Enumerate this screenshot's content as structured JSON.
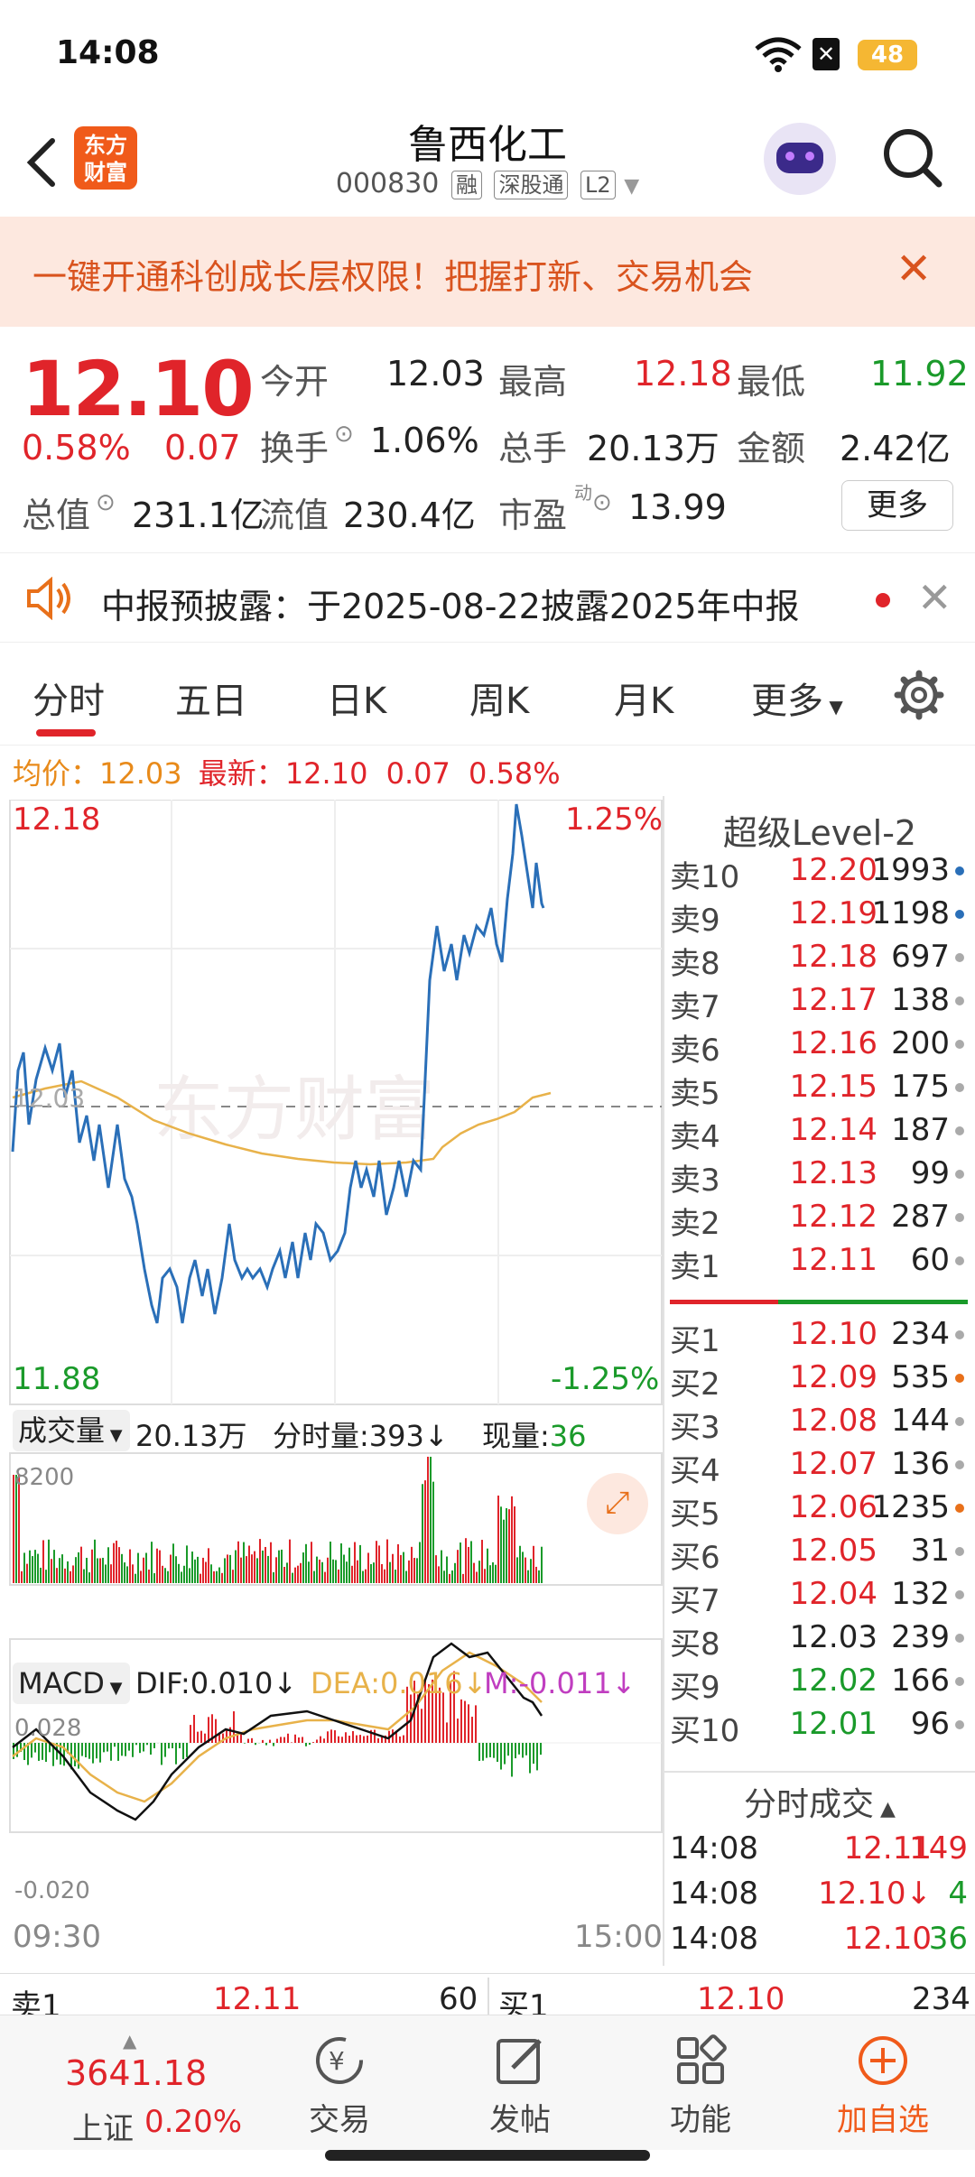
{
  "status": {
    "time": "14:08",
    "battery": "48"
  },
  "header": {
    "logo_line1": "东方",
    "logo_line2": "财富",
    "stock_name": "鲁西化工",
    "stock_code": "000830",
    "tags": [
      "融",
      "深股通",
      "L2"
    ]
  },
  "banner": {
    "text": "一键开通科创成长层权限！把握打新、交易机会"
  },
  "quote": {
    "last_price": "12.10",
    "change_pct": "0.58%",
    "change_amt": "0.07",
    "open_label": "今开",
    "open": "12.03",
    "high_label": "最高",
    "high": "12.18",
    "low_label": "最低",
    "low": "11.92",
    "turnover_label": "换手",
    "turnover": "1.06%",
    "volume_label": "总手",
    "volume": "20.13万",
    "amount_label": "金额",
    "amount": "2.42亿",
    "mktcap_label": "总值",
    "mktcap": "231.1亿",
    "float_label": "流值",
    "float": "230.4亿",
    "pe_label": "市盈",
    "pe_sup": "动",
    "pe": "13.99",
    "more_label": "更多"
  },
  "notice": {
    "text": "中报预披露：于2025-08-22披露2025年中报"
  },
  "tabs": [
    "分时",
    "五日",
    "日K",
    "周K",
    "月K",
    "更多"
  ],
  "avg_line": {
    "avg_label": "均价：",
    "avg": "12.03",
    "latest_label": "最新：",
    "latest": "12.10",
    "chg": "0.07",
    "pct": "0.58%"
  },
  "chart_axis": {
    "price_top": "12.18",
    "price_bottom": "11.88",
    "pct_top": "1.25%",
    "pct_bottom": "-1.25%",
    "mid": "12.03",
    "watermark": "东方财富",
    "time_start": "09:30",
    "time_end": "15:00"
  },
  "volume_header": {
    "selector": "成交量",
    "total": "20.13万",
    "period_label": "分时量:",
    "period": "393",
    "now_label": "现量:",
    "now": "36",
    "max": "8200"
  },
  "macd_header": {
    "selector": "MACD",
    "dif": "DIF:0.010",
    "dea": "DEA:0.016",
    "m": "M:-0.011",
    "top": "0.028",
    "bottom": "-0.020"
  },
  "order_book": {
    "title": "超级Level-2",
    "asks": [
      {
        "label": "卖10",
        "price": "12.20",
        "vol": "1993",
        "dot": "#2a6fb8"
      },
      {
        "label": "卖9",
        "price": "12.19",
        "vol": "1198",
        "dot": "#2a6fb8"
      },
      {
        "label": "卖8",
        "price": "12.18",
        "vol": "697",
        "dot": "#aaaaaa"
      },
      {
        "label": "卖7",
        "price": "12.17",
        "vol": "138",
        "dot": "#aaaaaa"
      },
      {
        "label": "卖6",
        "price": "12.16",
        "vol": "200",
        "dot": "#aaaaaa"
      },
      {
        "label": "卖5",
        "price": "12.15",
        "vol": "175",
        "dot": "#aaaaaa"
      },
      {
        "label": "卖4",
        "price": "12.14",
        "vol": "187",
        "dot": "#aaaaaa"
      },
      {
        "label": "卖3",
        "price": "12.13",
        "vol": "99",
        "dot": "#aaaaaa"
      },
      {
        "label": "卖2",
        "price": "12.12",
        "vol": "287",
        "dot": "#aaaaaa"
      },
      {
        "label": "卖1",
        "price": "12.11",
        "vol": "60",
        "dot": "#aaaaaa"
      }
    ],
    "bids": [
      {
        "label": "买1",
        "price": "12.10",
        "vol": "234",
        "dot": "#aaaaaa"
      },
      {
        "label": "买2",
        "price": "12.09",
        "vol": "535",
        "dot": "#e8701a"
      },
      {
        "label": "买3",
        "price": "12.08",
        "vol": "144",
        "dot": "#aaaaaa"
      },
      {
        "label": "买4",
        "price": "12.07",
        "vol": "136",
        "dot": "#aaaaaa"
      },
      {
        "label": "买5",
        "price": "12.06",
        "vol": "1235",
        "dot": "#e8701a"
      },
      {
        "label": "买6",
        "price": "12.05",
        "vol": "31",
        "dot": "#aaaaaa"
      },
      {
        "label": "买7",
        "price": "12.04",
        "vol": "132",
        "dot": "#aaaaaa"
      },
      {
        "label": "买8",
        "price": "12.03",
        "vol": "239",
        "dot": "#aaaaaa"
      },
      {
        "label": "买9",
        "price": "12.02",
        "vol": "166",
        "dot": "#aaaaaa"
      },
      {
        "label": "买10",
        "price": "12.01",
        "vol": "96",
        "dot": "#aaaaaa"
      }
    ]
  },
  "trades": {
    "title": "分时成交",
    "rows": [
      {
        "time": "14:08",
        "price": "12.11",
        "vol": "149"
      },
      {
        "time": "14:08",
        "price": "12.10↓",
        "vol": "4"
      },
      {
        "time": "14:08",
        "price": "12.10",
        "vol": "36"
      }
    ]
  },
  "bottom_quote": {
    "ask_label": "卖1",
    "ask_price": "12.11",
    "ask_vol": "60",
    "bid_label": "买1",
    "bid_price": "12.10",
    "bid_vol": "234"
  },
  "bottom_nav": {
    "index_value": "3641.18",
    "index_name": "上证",
    "index_pct": "0.20%",
    "trade": "交易",
    "post": "发帖",
    "function": "功能",
    "watch": "加自选"
  },
  "colors": {
    "up": "#e0242a",
    "down": "#1a9a2a",
    "price_line": "#2a6fb8",
    "avg_line": "#e8b24a",
    "accent": "#f05a1a"
  }
}
